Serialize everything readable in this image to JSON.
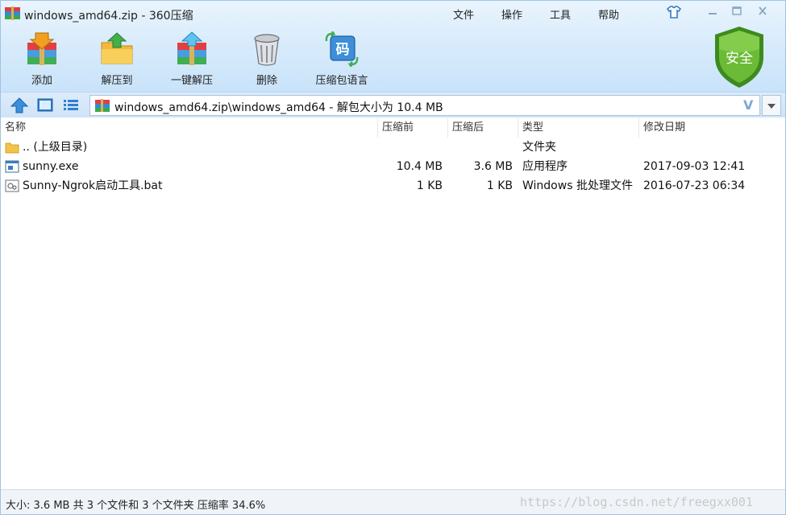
{
  "window": {
    "title": "windows_amd64.zip - 360压缩"
  },
  "menu": {
    "file": "文件",
    "operate": "操作",
    "tools": "工具",
    "help": "帮助"
  },
  "security_badge": "安全",
  "toolbar": {
    "add": "添加",
    "extract_to": "解压到",
    "one_click_extract": "一键解压",
    "delete": "删除",
    "archive_language": "压缩包语言"
  },
  "address": {
    "path": "windows_amd64.zip\\windows_amd64 - 解包大小为 10.4 MB",
    "v_mark": "V"
  },
  "columns": {
    "name": "名称",
    "compressed": "压缩前",
    "packed": "压缩后",
    "type": "类型",
    "modified": "修改日期"
  },
  "files": [
    {
      "name": ".. (上级目录)",
      "compressed": "",
      "packed": "",
      "type": "文件夹",
      "modified": ""
    },
    {
      "name": "sunny.exe",
      "compressed": "10.4 MB",
      "packed": "3.6 MB",
      "type": "应用程序",
      "modified": "2017-09-03 12:41"
    },
    {
      "name": "Sunny-Ngrok启动工具.bat",
      "compressed": "1 KB",
      "packed": "1 KB",
      "type": "Windows 批处理文件",
      "modified": "2016-07-23 06:34"
    }
  ],
  "status": {
    "text": "大小: 3.6 MB 共 3 个文件和 3 个文件夹 压缩率 34.6%",
    "watermark": "https://blog.csdn.net/freegxx001"
  },
  "colors": {
    "accent": "#3a7cc4",
    "shield_green": "#5aa52c",
    "header_bg": "#d6eafb"
  }
}
